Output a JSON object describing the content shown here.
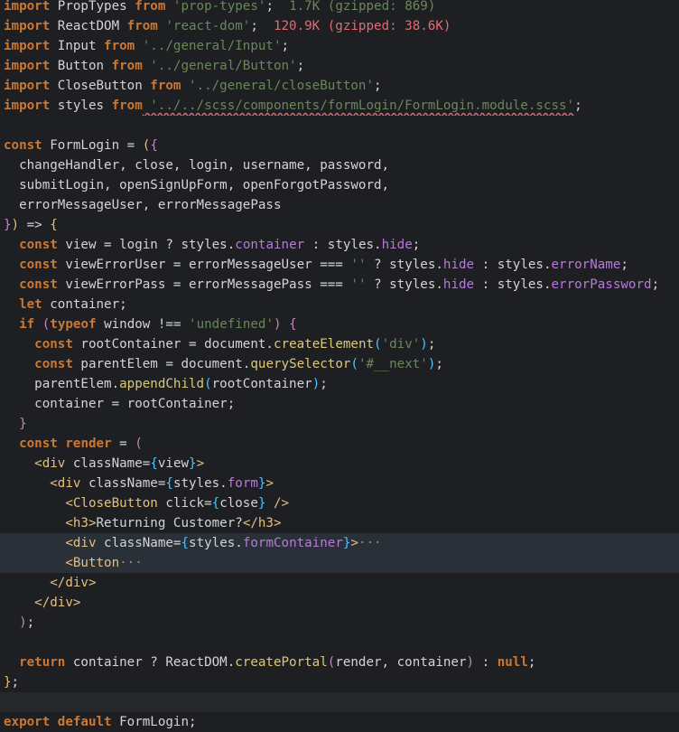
{
  "editor": {
    "lines": [
      {
        "id": "l1",
        "tokens": [
          [
            "kw",
            "import"
          ],
          [
            "id",
            " PropTypes "
          ],
          [
            "kw",
            "from"
          ],
          [
            "str",
            " 'prop-types'"
          ],
          [
            "punct",
            ";"
          ],
          [
            "gz",
            "  1.7K (gzipped: 869)"
          ]
        ]
      },
      {
        "id": "l2",
        "tokens": [
          [
            "kw",
            "import"
          ],
          [
            "id",
            " ReactDOM "
          ],
          [
            "kw",
            "from"
          ],
          [
            "str",
            " 'react-dom'"
          ],
          [
            "punct",
            ";"
          ],
          [
            "red",
            "  120.9K (gzipped: 38.6K)"
          ]
        ]
      },
      {
        "id": "l3",
        "tokens": [
          [
            "kw",
            "import"
          ],
          [
            "id",
            " Input "
          ],
          [
            "kw",
            "from"
          ],
          [
            "str",
            " '../general/Input'"
          ],
          [
            "punct",
            ";"
          ]
        ]
      },
      {
        "id": "l4",
        "tokens": [
          [
            "kw",
            "import"
          ],
          [
            "id",
            " Button "
          ],
          [
            "kw",
            "from"
          ],
          [
            "str",
            " '../general/Button'"
          ],
          [
            "punct",
            ";"
          ]
        ]
      },
      {
        "id": "l5",
        "tokens": [
          [
            "kw",
            "import"
          ],
          [
            "id",
            " CloseButton "
          ],
          [
            "kw",
            "from"
          ],
          [
            "str",
            " '../general/closeButton'"
          ],
          [
            "punct",
            ";"
          ]
        ]
      },
      {
        "id": "l6",
        "tokens": [
          [
            "kw",
            "import"
          ],
          [
            "id",
            " styles "
          ],
          [
            "kw",
            "from"
          ],
          [
            "str squiggle",
            " '../../scss/components/formLogin/FormLogin.module.scss'"
          ],
          [
            "punct",
            ";"
          ]
        ]
      },
      {
        "id": "l7",
        "tokens": []
      },
      {
        "id": "l8",
        "tokens": [
          [
            "kw",
            "const"
          ],
          [
            "id",
            " FormLogin = "
          ],
          [
            "brace1",
            "("
          ],
          [
            "brace2",
            "{"
          ]
        ]
      },
      {
        "id": "l9",
        "tokens": [
          [
            "id",
            "  changeHandler, close, login, username, password,"
          ]
        ]
      },
      {
        "id": "l10",
        "tokens": [
          [
            "id",
            "  submitLogin, openSignUpForm, openForgotPassword,"
          ]
        ]
      },
      {
        "id": "l11",
        "tokens": [
          [
            "id",
            "  errorMessageUser, errorMessagePass"
          ]
        ]
      },
      {
        "id": "l12",
        "tokens": [
          [
            "brace2",
            "}"
          ],
          [
            "brace1",
            ")"
          ],
          [
            "id",
            " => "
          ],
          [
            "brace1",
            "{"
          ]
        ]
      },
      {
        "id": "l13",
        "tokens": [
          [
            "id",
            "  "
          ],
          [
            "kw",
            "const"
          ],
          [
            "id",
            " view = login ? styles."
          ],
          [
            "prop",
            "container"
          ],
          [
            "id",
            " : styles."
          ],
          [
            "prop",
            "hide"
          ],
          [
            "punct",
            ";"
          ]
        ]
      },
      {
        "id": "l14",
        "tokens": [
          [
            "id",
            "  "
          ],
          [
            "kw",
            "const"
          ],
          [
            "id",
            " viewErrorUser = errorMessageUser === "
          ],
          [
            "str",
            "''"
          ],
          [
            "id",
            " ? styles."
          ],
          [
            "prop",
            "hide"
          ],
          [
            "id",
            " : styles."
          ],
          [
            "prop",
            "errorName"
          ],
          [
            "punct",
            ";"
          ]
        ]
      },
      {
        "id": "l15",
        "tokens": [
          [
            "id",
            "  "
          ],
          [
            "kw",
            "const"
          ],
          [
            "id",
            " viewErrorPass = errorMessagePass === "
          ],
          [
            "str",
            "''"
          ],
          [
            "id",
            " ? styles."
          ],
          [
            "prop",
            "hide"
          ],
          [
            "id",
            " : styles."
          ],
          [
            "prop",
            "errorPassword"
          ],
          [
            "punct",
            ";"
          ]
        ]
      },
      {
        "id": "l16",
        "tokens": [
          [
            "id",
            "  "
          ],
          [
            "kw",
            "let"
          ],
          [
            "id",
            " container;"
          ]
        ]
      },
      {
        "id": "l17",
        "tokens": [
          [
            "id",
            "  "
          ],
          [
            "kw",
            "if"
          ],
          [
            "id",
            " "
          ],
          [
            "brace2",
            "("
          ],
          [
            "kw",
            "typeof"
          ],
          [
            "id",
            " window !== "
          ],
          [
            "str",
            "'undefined'"
          ],
          [
            "brace2",
            ")"
          ],
          [
            "id",
            " "
          ],
          [
            "brace2",
            "{"
          ]
        ]
      },
      {
        "id": "l18",
        "tokens": [
          [
            "id",
            "    "
          ],
          [
            "kw",
            "const"
          ],
          [
            "id",
            " rootContainer = document."
          ],
          [
            "fn",
            "createElement"
          ],
          [
            "brace3",
            "("
          ],
          [
            "str",
            "'div'"
          ],
          [
            "brace3",
            ")"
          ],
          [
            "punct",
            ";"
          ]
        ]
      },
      {
        "id": "l19",
        "tokens": [
          [
            "id",
            "    "
          ],
          [
            "kw",
            "const"
          ],
          [
            "id",
            " parentElem = document."
          ],
          [
            "fn",
            "querySelector"
          ],
          [
            "brace3",
            "("
          ],
          [
            "str",
            "'#__next'"
          ],
          [
            "brace3",
            ")"
          ],
          [
            "punct",
            ";"
          ]
        ]
      },
      {
        "id": "l20",
        "tokens": [
          [
            "id",
            "    parentElem."
          ],
          [
            "fn",
            "appendChild"
          ],
          [
            "brace3",
            "("
          ],
          [
            "id",
            "rootContainer"
          ],
          [
            "brace3",
            ")"
          ],
          [
            "punct",
            ";"
          ]
        ]
      },
      {
        "id": "l21",
        "tokens": [
          [
            "id",
            "    container = rootContainer;"
          ]
        ]
      },
      {
        "id": "l22",
        "tokens": [
          [
            "id",
            "  "
          ],
          [
            "brace2",
            "}"
          ]
        ]
      },
      {
        "id": "l23",
        "tokens": [
          [
            "id",
            "  "
          ],
          [
            "kw",
            "const"
          ],
          [
            "id",
            " "
          ],
          [
            "kw",
            "render"
          ],
          [
            "id",
            " = "
          ],
          [
            "brace2",
            "("
          ]
        ]
      },
      {
        "id": "l24",
        "tokens": [
          [
            "id",
            "    "
          ],
          [
            "tag",
            "<div"
          ],
          [
            "id",
            " className="
          ],
          [
            "brace3",
            "{"
          ],
          [
            "id",
            "view"
          ],
          [
            "brace3",
            "}"
          ],
          [
            "tag",
            ">"
          ]
        ]
      },
      {
        "id": "l25",
        "tokens": [
          [
            "id",
            "      "
          ],
          [
            "tag",
            "<div"
          ],
          [
            "id",
            " className="
          ],
          [
            "brace3",
            "{"
          ],
          [
            "id",
            "styles."
          ],
          [
            "prop",
            "form"
          ],
          [
            "brace3",
            "}"
          ],
          [
            "tag",
            ">"
          ]
        ]
      },
      {
        "id": "l26",
        "tokens": [
          [
            "id",
            "        "
          ],
          [
            "tag",
            "<CloseButton"
          ],
          [
            "id",
            " click="
          ],
          [
            "brace3",
            "{"
          ],
          [
            "id",
            "close"
          ],
          [
            "brace3",
            "}"
          ],
          [
            "tag",
            " />"
          ]
        ]
      },
      {
        "id": "l27",
        "tokens": [
          [
            "id",
            "        "
          ],
          [
            "tag",
            "<h3>"
          ],
          [
            "id",
            "Returning Customer?"
          ],
          [
            "tag",
            "</h3>"
          ]
        ]
      },
      {
        "id": "l28",
        "tokens": [
          [
            "id",
            "        "
          ],
          [
            "tag",
            "<div"
          ],
          [
            "id",
            " className="
          ],
          [
            "brace3",
            "{"
          ],
          [
            "id",
            "styles."
          ],
          [
            "prop",
            "formContainer"
          ],
          [
            "brace3",
            "}"
          ],
          [
            "tag",
            ">"
          ],
          [
            "dim",
            "···"
          ]
        ]
      },
      {
        "id": "l29",
        "tokens": [
          [
            "id",
            "        "
          ],
          [
            "tag",
            "<Button"
          ],
          [
            "dim",
            "···"
          ]
        ]
      },
      {
        "id": "l30",
        "tokens": [
          [
            "id",
            "      "
          ],
          [
            "tag",
            "</div>"
          ]
        ]
      },
      {
        "id": "l31",
        "tokens": [
          [
            "id",
            "    "
          ],
          [
            "tag",
            "</div>"
          ]
        ]
      },
      {
        "id": "l32",
        "tokens": [
          [
            "id",
            "  "
          ],
          [
            "brace2",
            ")"
          ],
          [
            "punct",
            ";"
          ]
        ]
      },
      {
        "id": "l33",
        "tokens": []
      },
      {
        "id": "l34",
        "tokens": [
          [
            "id",
            "  "
          ],
          [
            "kw",
            "return"
          ],
          [
            "id",
            " container ? ReactDOM."
          ],
          [
            "fn",
            "createPortal"
          ],
          [
            "brace2",
            "("
          ],
          [
            "id",
            "render, container"
          ],
          [
            "brace2",
            ")"
          ],
          [
            "id",
            " : "
          ],
          [
            "kw",
            "null"
          ],
          [
            "punct",
            ";"
          ]
        ]
      },
      {
        "id": "l35",
        "tokens": [
          [
            "brace1",
            "}"
          ],
          [
            "punct",
            ";"
          ]
        ]
      },
      {
        "id": "l36",
        "tokens": []
      },
      {
        "id": "l37",
        "tokens": [
          [
            "kw",
            "export"
          ],
          [
            "id",
            " "
          ],
          [
            "kw",
            "default"
          ],
          [
            "id",
            " FormLogin;"
          ]
        ]
      }
    ]
  }
}
